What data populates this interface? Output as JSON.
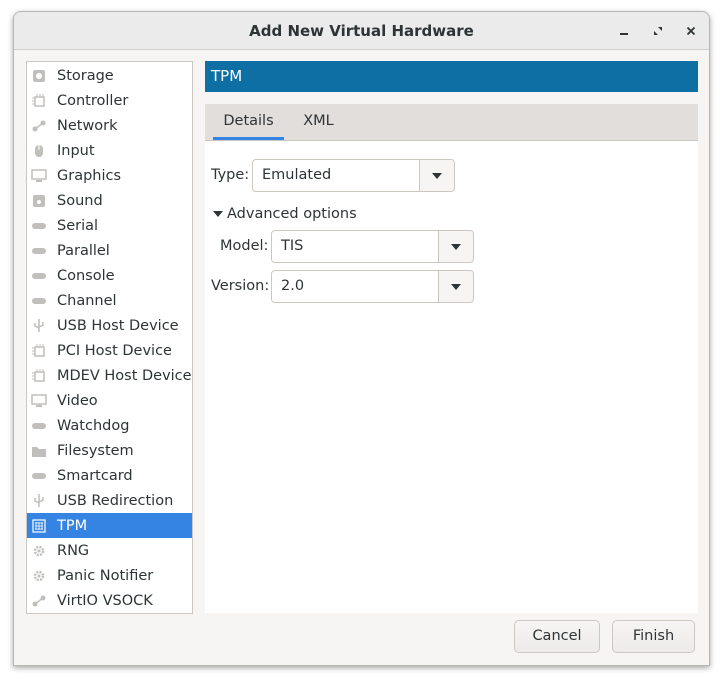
{
  "window": {
    "title": "Add New Virtual Hardware",
    "controls": [
      "minimize-icon",
      "maximize-icon",
      "close-icon"
    ]
  },
  "sidebar": {
    "items": [
      {
        "label": "Storage",
        "icon": "disk-icon"
      },
      {
        "label": "Controller",
        "icon": "chip-icon"
      },
      {
        "label": "Network",
        "icon": "network-icon"
      },
      {
        "label": "Input",
        "icon": "mouse-icon"
      },
      {
        "label": "Graphics",
        "icon": "monitor-icon"
      },
      {
        "label": "Sound",
        "icon": "sound-icon"
      },
      {
        "label": "Serial",
        "icon": "serial-port-icon"
      },
      {
        "label": "Parallel",
        "icon": "parallel-port-icon"
      },
      {
        "label": "Console",
        "icon": "console-icon"
      },
      {
        "label": "Channel",
        "icon": "channel-icon"
      },
      {
        "label": "USB Host Device",
        "icon": "usb-icon"
      },
      {
        "label": "PCI Host Device",
        "icon": "pci-icon"
      },
      {
        "label": "MDEV Host Device",
        "icon": "mdev-icon"
      },
      {
        "label": "Video",
        "icon": "video-icon"
      },
      {
        "label": "Watchdog",
        "icon": "watchdog-icon"
      },
      {
        "label": "Filesystem",
        "icon": "folder-icon"
      },
      {
        "label": "Smartcard",
        "icon": "smartcard-icon"
      },
      {
        "label": "USB Redirection",
        "icon": "usb-redirection-icon"
      },
      {
        "label": "TPM",
        "icon": "tpm-icon"
      },
      {
        "label": "RNG",
        "icon": "gear-icon"
      },
      {
        "label": "Panic Notifier",
        "icon": "gear-icon"
      },
      {
        "label": "VirtIO VSOCK",
        "icon": "network-icon"
      }
    ],
    "selected": "TPM"
  },
  "panel": {
    "header": "TPM",
    "tabs": [
      {
        "label": "Details",
        "active": true
      },
      {
        "label": "XML",
        "active": false
      }
    ],
    "type_label": "Type:",
    "type_value": "Emulated",
    "advanced_label": "Advanced options",
    "model_label": "Model:",
    "model_value": "TIS",
    "version_label": "Version:",
    "version_value": "2.0"
  },
  "footer": {
    "cancel_label": "Cancel",
    "finish_label": "Finish"
  },
  "colors": {
    "selection": "#3584e4",
    "header": "#0e6fa5",
    "icon_gray": "#c0bfbc"
  }
}
